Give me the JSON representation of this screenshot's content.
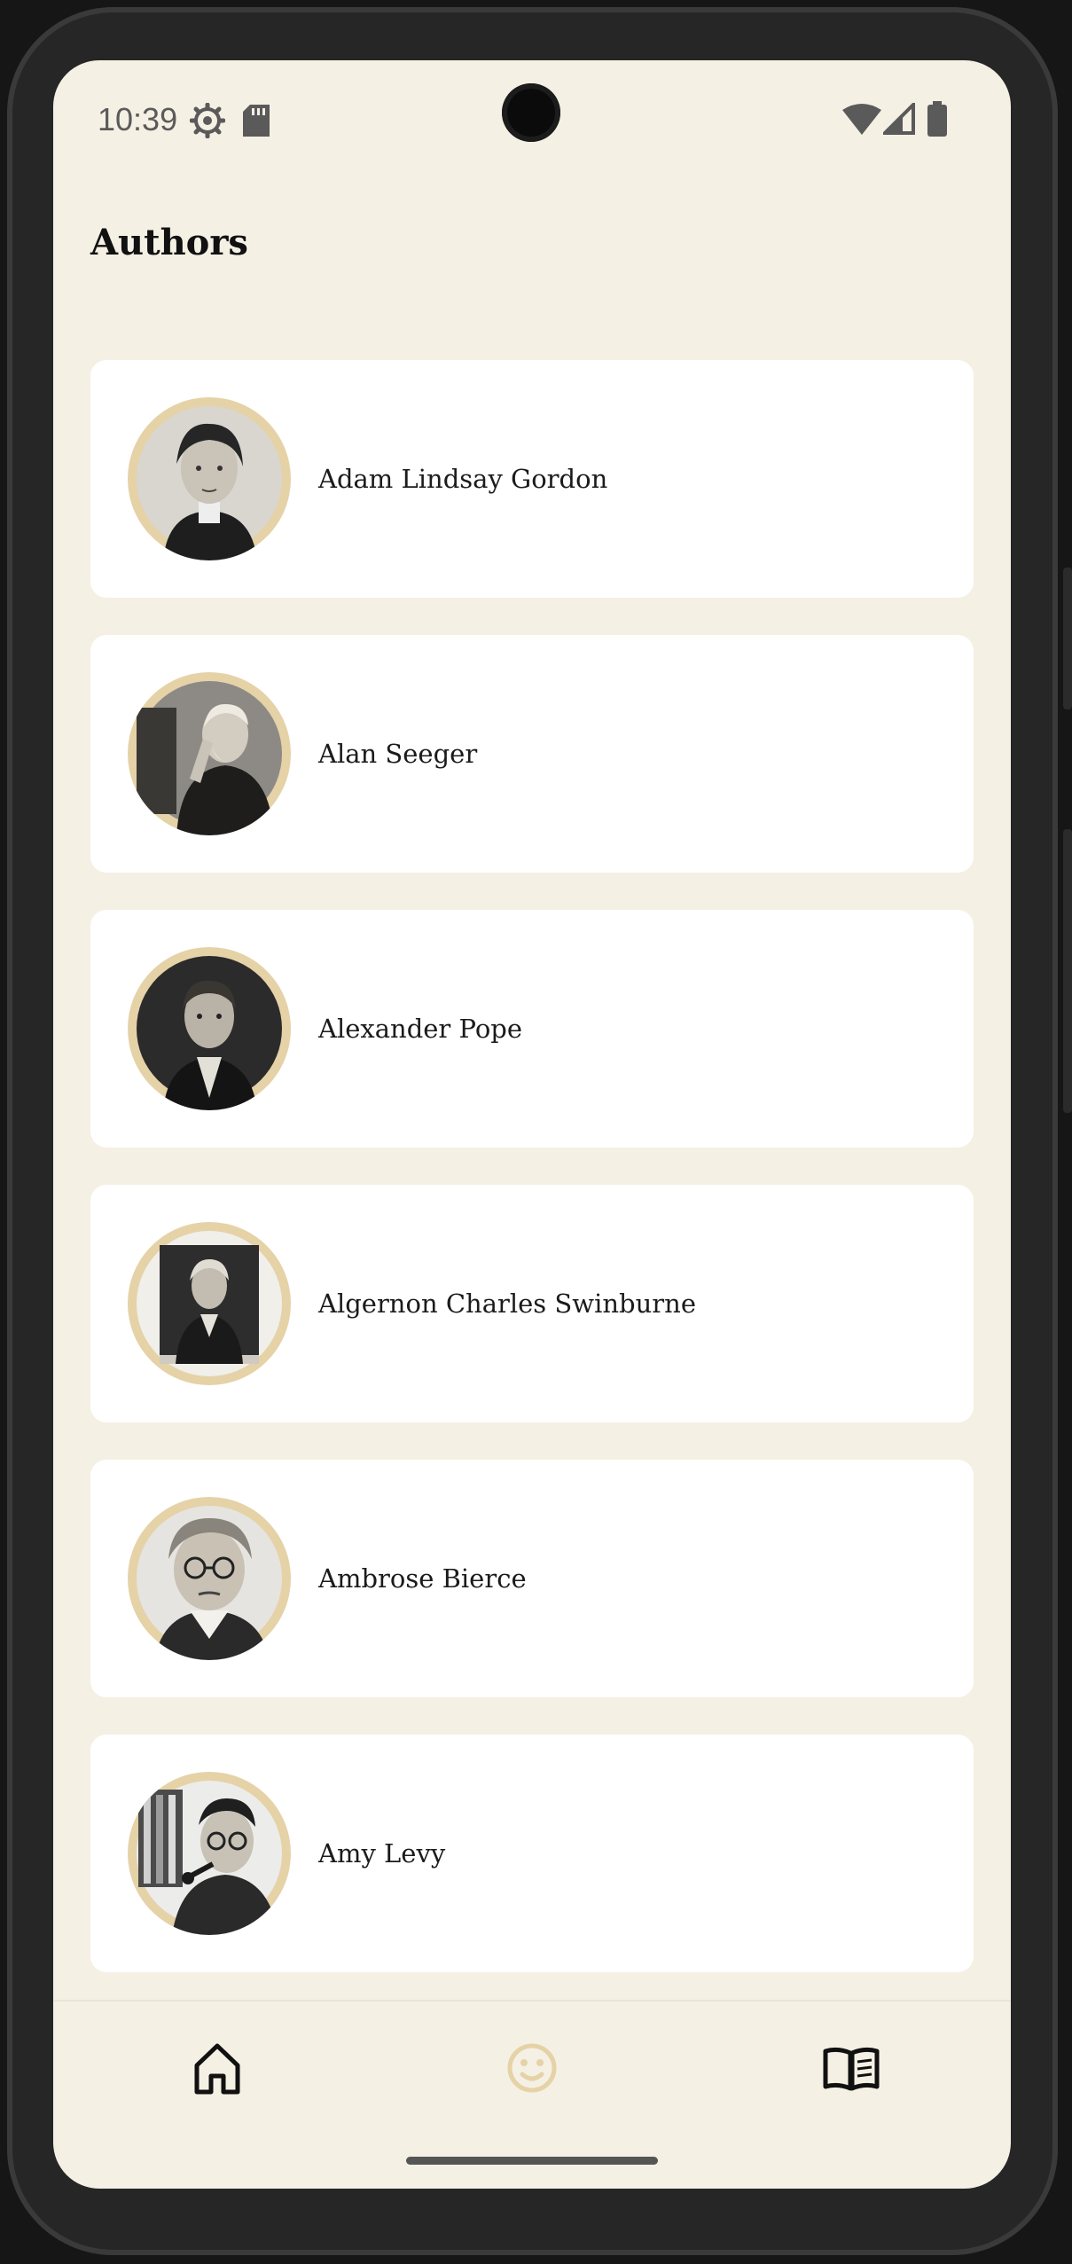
{
  "status_bar": {
    "time": "10:39",
    "icons": [
      "settings-gear-icon",
      "sd-card-icon",
      "wifi-icon",
      "signal-icon",
      "battery-icon"
    ]
  },
  "header": {
    "title": "Authors"
  },
  "authors": [
    {
      "name": "Adam Lindsay Gordon"
    },
    {
      "name": "Alan Seeger"
    },
    {
      "name": "Alexander Pope"
    },
    {
      "name": "Algernon Charles Swinburne"
    },
    {
      "name": "Ambrose Bierce"
    },
    {
      "name": "Amy Levy"
    }
  ],
  "bottom_nav": {
    "items": [
      {
        "icon": "home-icon",
        "active": false
      },
      {
        "icon": "smiley-icon",
        "active": true
      },
      {
        "icon": "open-book-icon",
        "active": false
      }
    ]
  },
  "colors": {
    "background": "#f5f0e4",
    "card": "#ffffff",
    "accent": "#e5d2a7",
    "text": "#1b1b1b"
  }
}
